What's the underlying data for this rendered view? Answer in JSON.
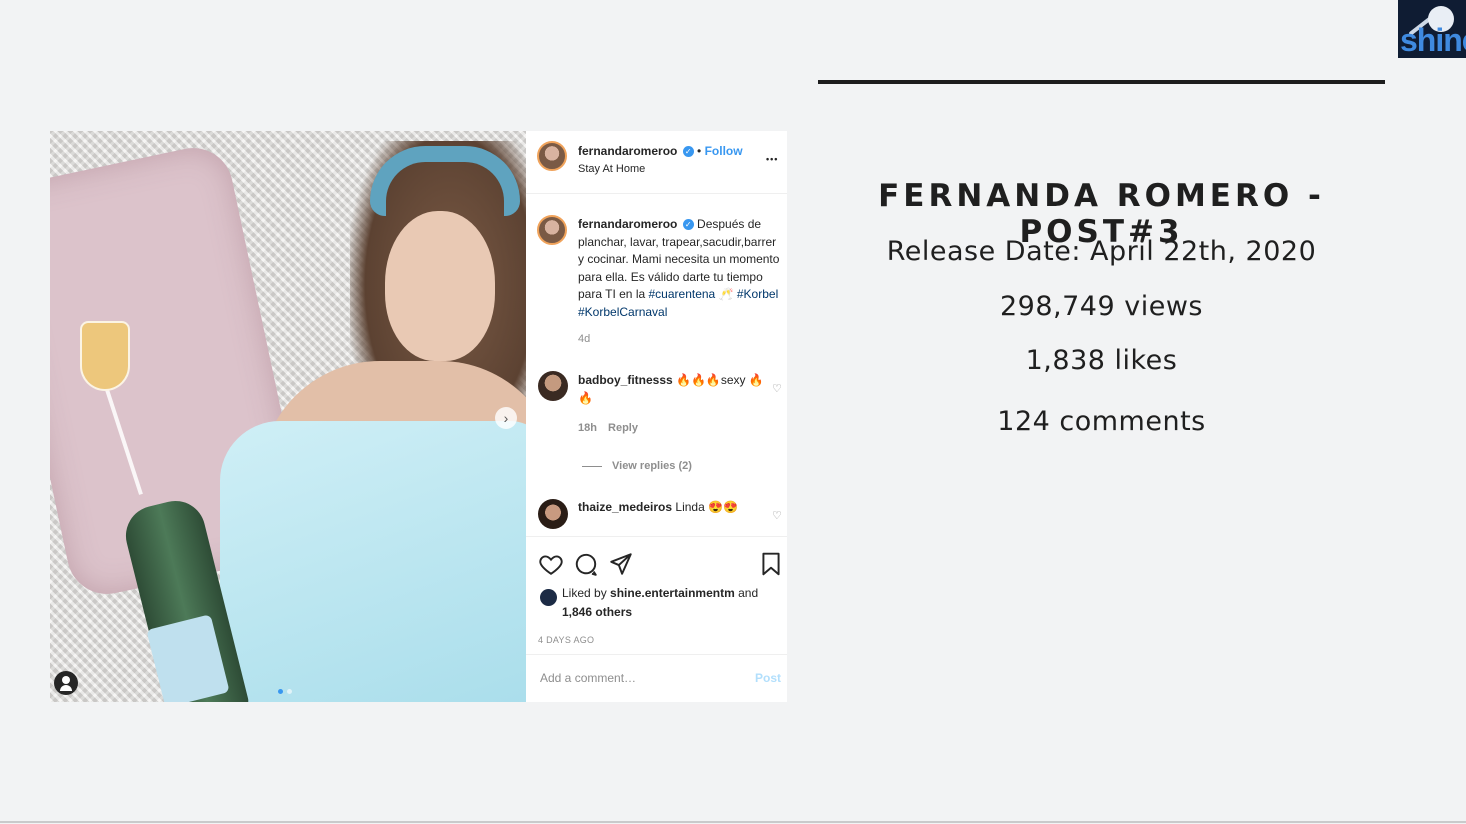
{
  "logo": {
    "text": "shine"
  },
  "slide": {
    "title": "FERNANDA ROMERO - POST#3",
    "release_date": "Release Date: April 22th, 2020",
    "views": "298,749 views",
    "likes": "1,838 likes",
    "comments": "124 comments"
  },
  "post": {
    "username": "fernandaromeroo",
    "follow_label": "Follow",
    "separator": "•",
    "location": "Stay At Home",
    "more_label": "•••",
    "caption": {
      "username": "fernandaromeroo",
      "text": "Después de planchar, lavar, trapear,sacudir,barrer y cocinar. Mami necesita un momento para ella. Es válido darte tu tiempo para TI en la",
      "hashtag1": "#cuarentena",
      "emoji": "🥂",
      "hashtag2": "#Korbel",
      "hashtag3": "#KorbelCarnaval",
      "time": "4d"
    },
    "comments": [
      {
        "username": "badboy_fitnesss",
        "text": "🔥🔥🔥sexy 🔥🔥",
        "time": "18h",
        "reply_label": "Reply"
      },
      {
        "username": "thaize_medeiros",
        "text": "Linda 😍😍"
      }
    ],
    "view_replies": "View replies (2)",
    "liked_by": {
      "prefix": "Liked by",
      "user": "shine.entertainmentm",
      "and": "and",
      "others": "1,846 others"
    },
    "time_ago": "4 DAYS AGO",
    "add_comment_placeholder": "Add a comment…",
    "post_button": "Post"
  },
  "colors": {
    "accent": "#3897f0",
    "background": "#f2f3f4",
    "title_rule": "#1d1d1d"
  },
  "icons": [
    "heart-icon",
    "comment-icon",
    "share-icon",
    "bookmark-icon",
    "more-icon",
    "verified-icon",
    "next-arrow-icon",
    "tag-user-icon"
  ]
}
